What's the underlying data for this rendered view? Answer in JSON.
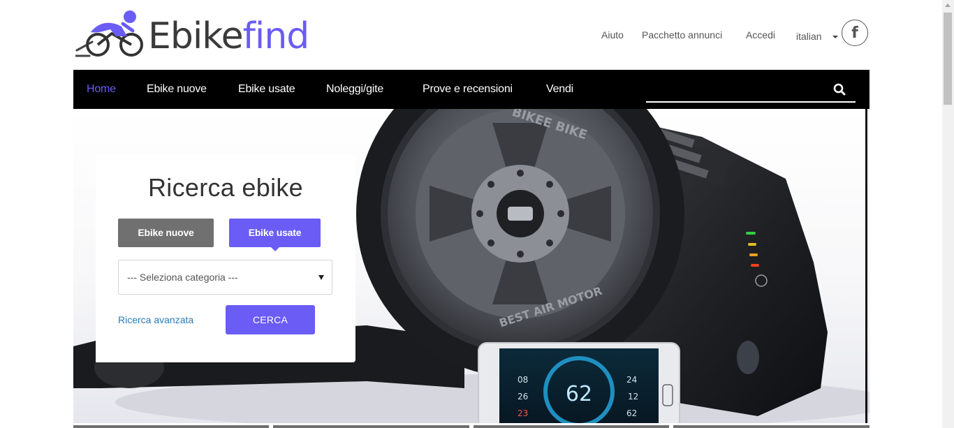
{
  "logo": {
    "text_part1": "Ebike",
    "text_part2": "find"
  },
  "toplinks": {
    "help": "Aiuto",
    "ads_package": "Pacchetto annunci",
    "login": "Accedi",
    "language": "italian"
  },
  "social": {
    "facebook_icon": "facebook-icon",
    "facebook_glyph": "f"
  },
  "nav": {
    "items": [
      {
        "label": "Home",
        "active": true
      },
      {
        "label": "Ebike nuove",
        "active": false
      },
      {
        "label": "Ebike usate",
        "active": false
      },
      {
        "label": "Noleggi/gite",
        "active": false
      },
      {
        "label": "Prove e recensioni",
        "active": false
      },
      {
        "label": "Vendi",
        "active": false
      }
    ],
    "search_value": "",
    "search_icon": "search-icon"
  },
  "search_panel": {
    "title": "Ricerca ebike",
    "tab_new": "Ebike nuove",
    "tab_used": "Ebike usate",
    "active_tab": "Ebike usate",
    "category_select": "--- Seleziona categoria ---",
    "advanced_link": "Ricerca avanzata",
    "search_button": "CERCA"
  },
  "hero": {
    "motor_brand": "BIKEE BIKE",
    "motor_label": "BEST AIR MOTOR",
    "phone_speed": "62",
    "phone_left_readouts": [
      "08",
      "26",
      "23"
    ],
    "phone_right_readouts": [
      "24",
      "12",
      "62"
    ]
  },
  "colors": {
    "accent": "#6a5cf5",
    "nav_bg": "#000000",
    "link": "#2a7ab5",
    "tab_inactive": "#707070"
  }
}
